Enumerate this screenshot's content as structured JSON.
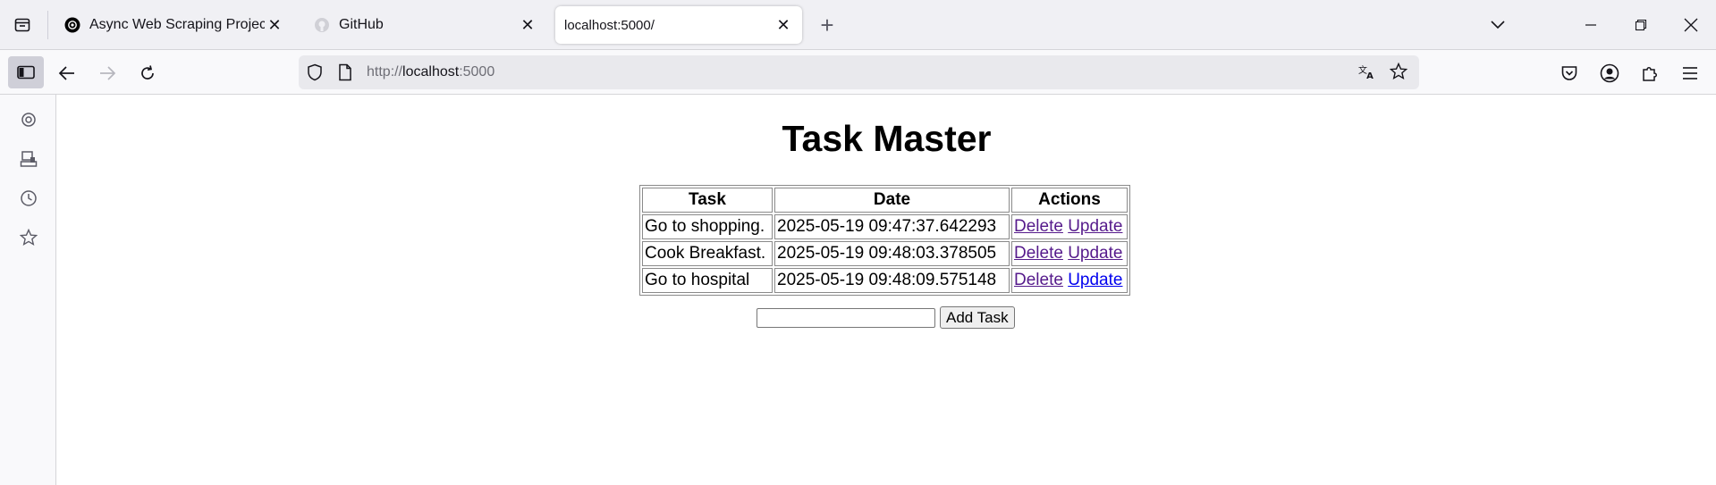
{
  "browser": {
    "tabs": [
      {
        "title": "Async Web Scraping Project",
        "favicon": "openai-icon",
        "active": false
      },
      {
        "title": "GitHub",
        "favicon": "github-icon",
        "active": false
      },
      {
        "title": "localhost:5000/",
        "favicon": "none",
        "active": true
      }
    ],
    "url": {
      "scheme": "http://",
      "host": "localhost",
      "port": ":5000"
    }
  },
  "page": {
    "title": "Task Master",
    "table": {
      "headers": [
        "Task",
        "Date",
        "Actions"
      ],
      "rows": [
        {
          "task": "Go to shopping.",
          "date": "2025-05-19 09:47:37.642293",
          "delete": "Delete",
          "update": "Update"
        },
        {
          "task": "Cook Breakfast.",
          "date": "2025-05-19 09:48:03.378505",
          "delete": "Delete",
          "update": "Update"
        },
        {
          "task": "Go to hospital",
          "date": "2025-05-19 09:48:09.575148",
          "delete": "Delete",
          "update": "Update"
        }
      ]
    },
    "form": {
      "input_value": "",
      "button_label": "Add Task"
    }
  },
  "colors": {
    "visited_link": "#551a8b",
    "unvisited_link": "#0000ee"
  }
}
